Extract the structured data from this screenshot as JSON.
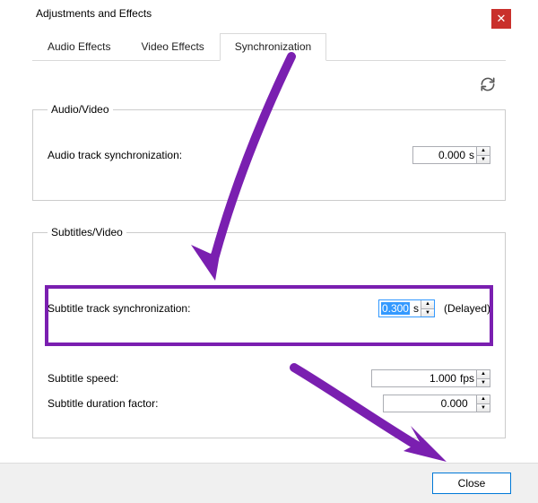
{
  "window": {
    "title": "Adjustments and Effects",
    "close_glyph": "✕"
  },
  "tabs": {
    "audio": "Audio Effects",
    "video": "Video Effects",
    "sync": "Synchronization"
  },
  "icons": {
    "refresh": "⟳"
  },
  "sync": {
    "audio_group": "Audio/Video",
    "audio_track_label": "Audio track synchronization:",
    "audio_value": "0.000",
    "audio_unit": " s",
    "sub_group": "Subtitles/Video",
    "sub_track_label": "Subtitle track synchronization:",
    "sub_value": "0.300",
    "sub_unit": " s",
    "sub_hint": "(Delayed)",
    "sub_speed_label": "Subtitle speed:",
    "sub_speed_value": "1.000",
    "sub_speed_unit": " fps",
    "sub_duration_label": "Subtitle duration factor:",
    "sub_duration_value": "0.000"
  },
  "buttons": {
    "close": "Close"
  },
  "spin": {
    "up": "▲",
    "down": "▼"
  },
  "colors": {
    "accent": "#7a1fb0",
    "selection": "#3399ff",
    "close": "#c9302c"
  }
}
